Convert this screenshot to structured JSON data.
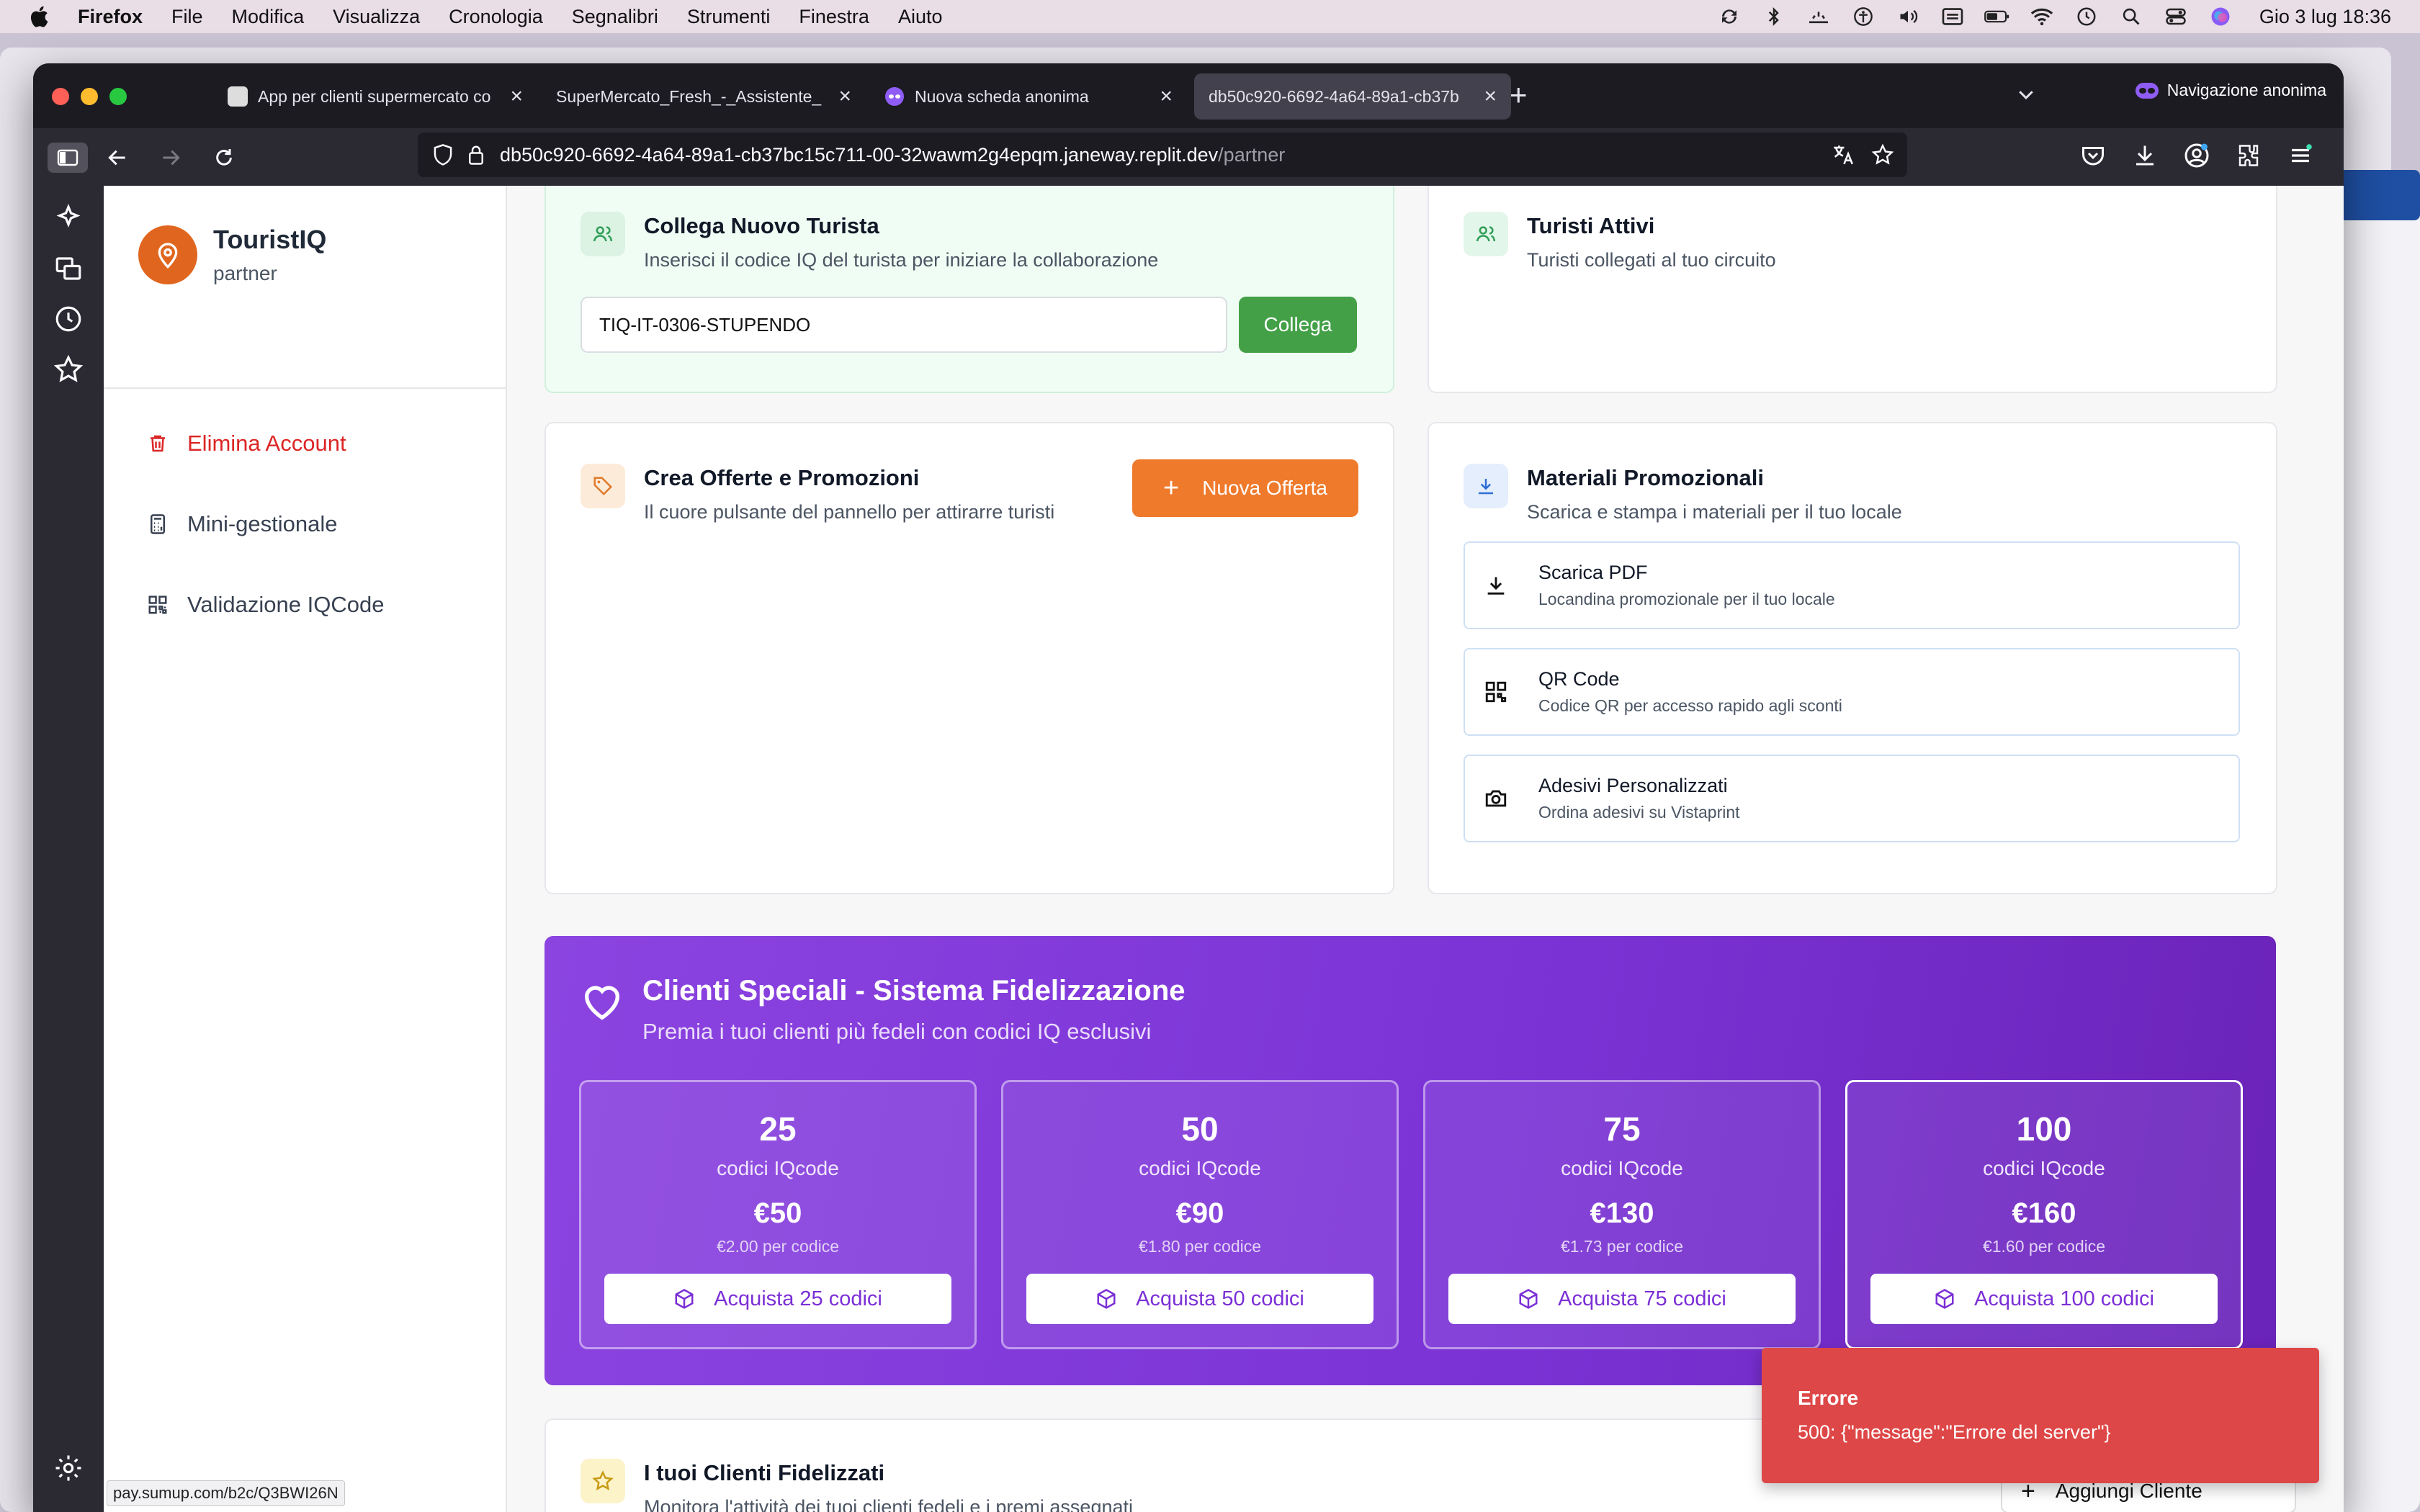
{
  "menubar": {
    "items": [
      "Firefox",
      "File",
      "Modifica",
      "Visualizza",
      "Cronologia",
      "Segnalibri",
      "Strumenti",
      "Finestra",
      "Aiuto"
    ],
    "clock": "Gio 3 lug  18:36"
  },
  "browser": {
    "tabs": [
      {
        "label": "App per clienti supermercato co"
      },
      {
        "label": "SuperMercato_Fresh_-_Assistente_"
      },
      {
        "label": "Nuova scheda anonima"
      },
      {
        "label": "db50c920-6692-4a64-89a1-cb37b"
      }
    ],
    "private_label": "Navigazione anonima",
    "url_host": "db50c920-6692-4a64-89a1-cb37bc15c711-00-32wawm2g4epqm.janeway.replit.dev",
    "url_path": "/partner",
    "status_url": "pay.sumup.com/b2c/Q3BWI26N"
  },
  "sidebar": {
    "brand_name": "TouristIQ",
    "brand_role": "partner",
    "items": [
      {
        "label": "Elimina Account"
      },
      {
        "label": "Mini-gestionale"
      },
      {
        "label": "Validazione IQCode"
      }
    ]
  },
  "connect": {
    "title": "Collega Nuovo Turista",
    "subtitle": "Inserisci il codice IQ del turista per iniziare la collaborazione",
    "input_value": "TIQ-IT-0306-STUPENDO",
    "button": "Collega"
  },
  "active": {
    "title": "Turisti Attivi",
    "subtitle": "Turisti collegati al tuo circuito"
  },
  "offers": {
    "title": "Crea Offerte e Promozioni",
    "subtitle": "Il cuore pulsante del pannello per attirarre turisti",
    "button": "Nuova Offerta"
  },
  "materials": {
    "title": "Materiali Promozionali",
    "subtitle": "Scarica e stampa i materiali per il tuo locale",
    "items": [
      {
        "title": "Scarica PDF",
        "sub": "Locandina promozionale per il tuo locale"
      },
      {
        "title": "QR Code",
        "sub": "Codice QR per accesso rapido agli sconti"
      },
      {
        "title": "Adesivi Personalizzati",
        "sub": "Ordina adesivi su Vistaprint"
      }
    ]
  },
  "loyalty": {
    "title": "Clienti Speciali - Sistema Fidelizzazione",
    "subtitle": "Premia i tuoi clienti più fedeli con codici IQ esclusivi",
    "packages": [
      {
        "count": "25",
        "label": "codici IQcode",
        "price": "€50",
        "unit": "€2.00 per codice",
        "button": "Acquista 25 codici"
      },
      {
        "count": "50",
        "label": "codici IQcode",
        "price": "€90",
        "unit": "€1.80 per codice",
        "button": "Acquista 50 codici"
      },
      {
        "count": "75",
        "label": "codici IQcode",
        "price": "€130",
        "unit": "€1.73 per codice",
        "button": "Acquista 75 codici"
      },
      {
        "count": "100",
        "label": "codici IQcode",
        "price": "€160",
        "unit": "€1.60 per codice",
        "button": "Acquista 100 codici"
      }
    ]
  },
  "clients": {
    "title": "I tuoi Clienti Fidelizzati",
    "subtitle": "Monitora l'attività dei tuoi clienti fedeli e i premi assegnati",
    "add_button": "Aggiungi Cliente"
  },
  "toast": {
    "title": "Errore",
    "message": "500: {\"message\":\"Errore del server\"}"
  },
  "colors": {
    "brand_orange": "#e0661f",
    "collega_green": "#43a047",
    "offer_orange": "#ef7a2c",
    "loyalty_purple": "#7b33d6",
    "error_red": "#de4747"
  }
}
